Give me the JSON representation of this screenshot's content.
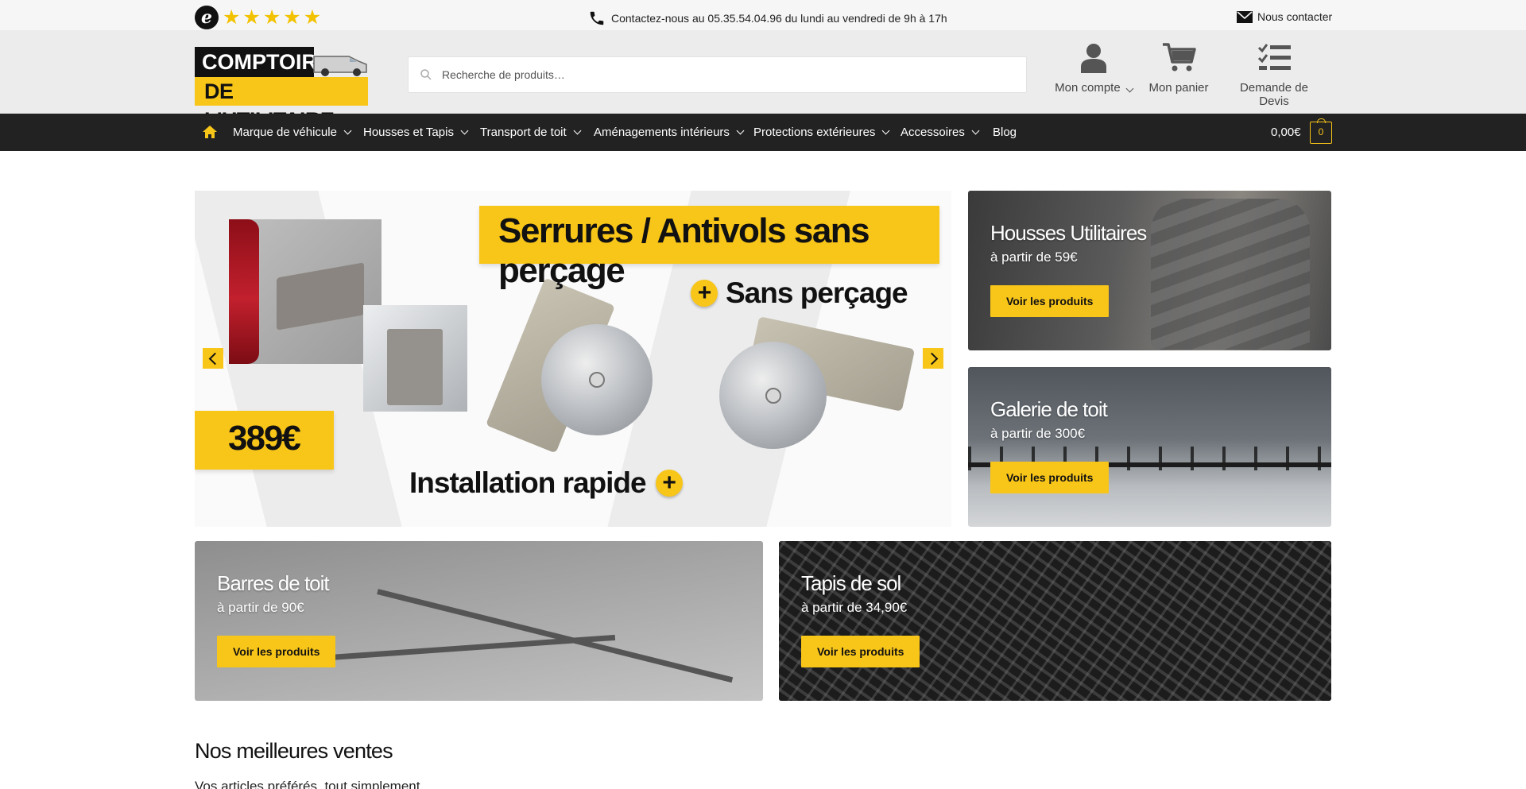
{
  "topbar": {
    "rating_logo_letter": "e",
    "rating_stars": 5,
    "contact_text": "Contactez-nous au 05.35.54.04.96 du lundi au vendredi de 9h à 17h",
    "nous_contacter": "Nous contacter"
  },
  "header": {
    "logo_line1": "COMPTOIR",
    "logo_line2": "DE L'UTILITAIRE",
    "search_placeholder": "Recherche de produits…",
    "account_label": "Mon compte",
    "cart_label": "Mon panier",
    "quote_label": "Demande de Devis"
  },
  "nav": {
    "items": [
      {
        "label": "Marque de véhicule",
        "dropdown": true
      },
      {
        "label": "Housses et Tapis",
        "dropdown": true
      },
      {
        "label": "Transport de toit",
        "dropdown": true
      },
      {
        "label": "Aménagements intérieurs",
        "dropdown": true
      },
      {
        "label": "Protections extérieures",
        "dropdown": true
      },
      {
        "label": "Accessoires",
        "dropdown": true
      },
      {
        "label": "Blog",
        "dropdown": false
      }
    ],
    "cart_total": "0,00€",
    "cart_count": "0"
  },
  "hero": {
    "headline": "Serrures / Antivols sans perçage",
    "feature1": "Sans perçage",
    "price": "389€",
    "feature2": "Installation rapide",
    "plus_symbol": "+"
  },
  "cards": [
    {
      "title": "Housses Utilitaires",
      "price": "à partir de 59€",
      "button": "Voir les produits"
    },
    {
      "title": "Galerie de toit",
      "price": "à partir de 300€",
      "button": "Voir les produits"
    },
    {
      "title": "Barres de toit",
      "price": "à partir de 90€",
      "button": "Voir les produits"
    },
    {
      "title": "Tapis de sol",
      "price": "à partir de 34,90€",
      "button": "Voir les produits"
    }
  ],
  "bestsellers": {
    "title": "Nos meilleures ventes",
    "subtitle": "Vos articles préférés, tout simplement."
  },
  "colors": {
    "accent_yellow": "#f8c519",
    "nav_bg": "#222222",
    "header_bg": "#ececec",
    "topbar_bg": "#f6f6f6",
    "star_color": "#f2c200"
  },
  "icons": {
    "phone": "phone-icon",
    "mail": "envelope-icon",
    "search": "search-icon",
    "account": "user-icon",
    "cart": "shopping-cart-icon",
    "quote": "checklist-icon",
    "home": "home-icon",
    "bag": "shopping-bag-icon"
  }
}
